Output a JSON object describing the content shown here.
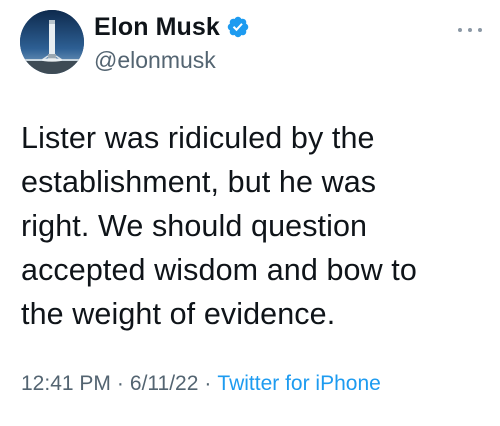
{
  "author": {
    "display_name": "Elon Musk",
    "handle": "@elonmusk",
    "verified": true,
    "avatar_icon": "rocket-launch-avatar"
  },
  "tweet": {
    "text": "Lister was ridiculed by the\nestablishment, but he was\nright. We should question\naccepted wisdom and bow to\nthe weight of evidence."
  },
  "meta": {
    "time": "12:41 PM",
    "separator": "·",
    "date": "6/11/22",
    "source": "Twitter for iPhone"
  },
  "colors": {
    "text": "#0f1419",
    "secondary": "#536471",
    "accent": "#1d9bf0"
  }
}
